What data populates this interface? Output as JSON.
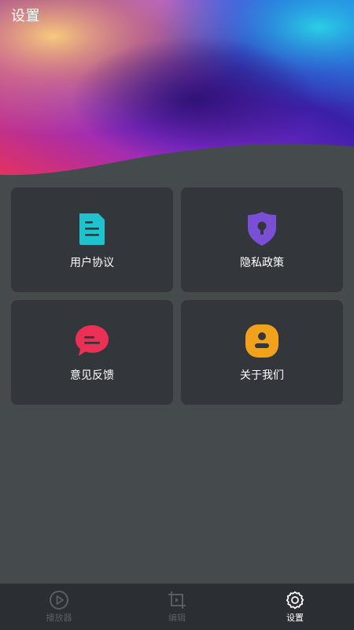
{
  "page": {
    "title": "设置"
  },
  "cards": [
    {
      "label": "用户协议",
      "icon": "document-icon",
      "color": "#1fc3cf"
    },
    {
      "label": "隐私政策",
      "icon": "shield-lock-icon",
      "color": "#7a4fd6"
    },
    {
      "label": "意见反馈",
      "icon": "chat-bubble-icon",
      "color": "#ec2f55"
    },
    {
      "label": "关于我们",
      "icon": "user-badge-icon",
      "color": "#f0a21c"
    }
  ],
  "nav": [
    {
      "label": "播放器",
      "icon": "play-circle-icon",
      "active": false
    },
    {
      "label": "编辑",
      "icon": "edit-crop-icon",
      "active": false
    },
    {
      "label": "设置",
      "icon": "gear-icon",
      "active": true
    }
  ],
  "colors": {
    "background": "#454a4d",
    "card": "#33363b",
    "nav_bar": "#2b2e32",
    "nav_inactive": "#5a5e63",
    "nav_active": "#ffffff"
  }
}
